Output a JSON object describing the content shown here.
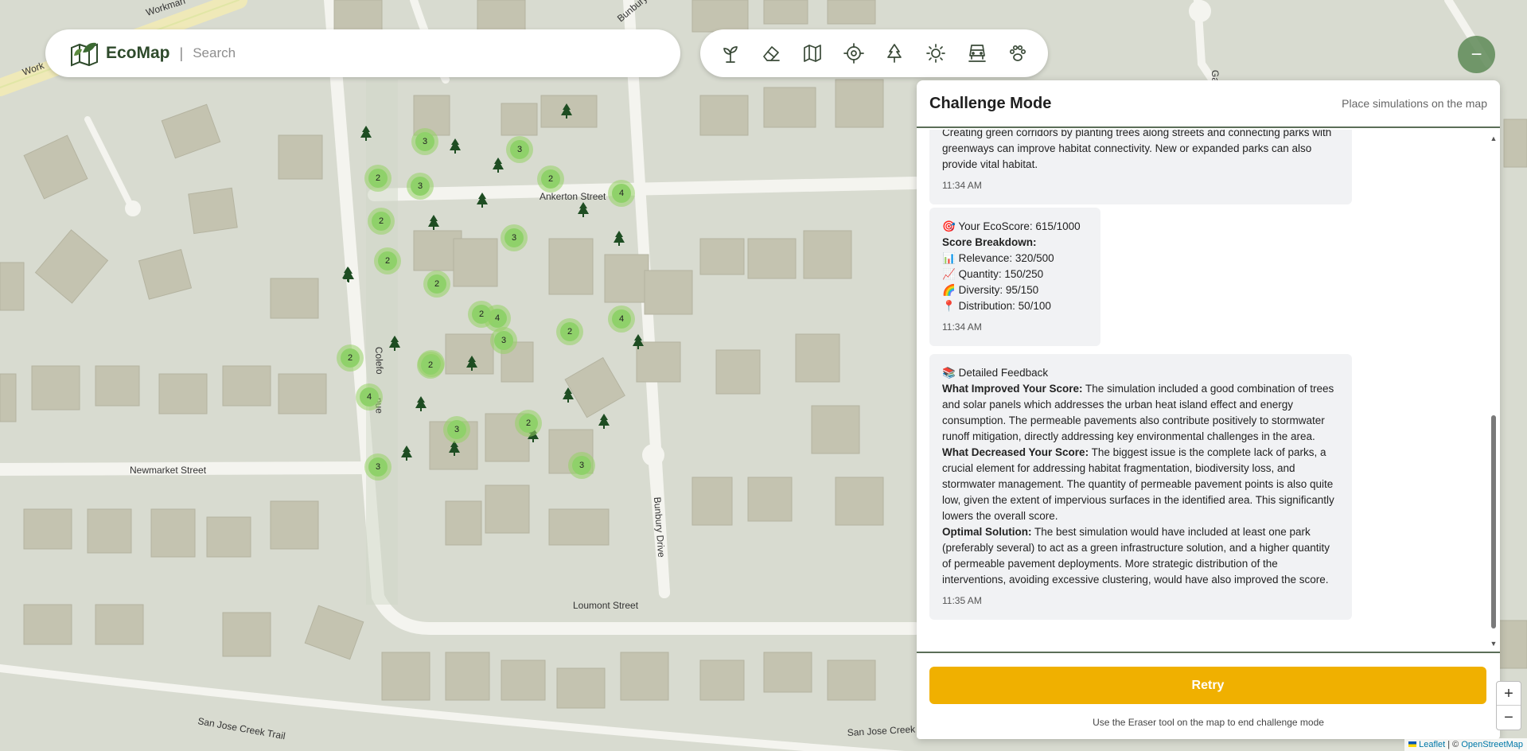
{
  "app": {
    "name": "EcoMap"
  },
  "search": {
    "placeholder": "Search"
  },
  "toolbar": {
    "tools": [
      "sapling-icon",
      "eraser-icon",
      "map-icon",
      "target-icon",
      "tree-icon",
      "sun-icon",
      "vehicle-icon",
      "paw-icon"
    ]
  },
  "map": {
    "streets": [
      "Workman",
      "Ankerton Street",
      "Newmarket Street",
      "Colefo",
      "nue",
      "Bunbury Drive",
      "Loumont Street",
      "San Jose Creek Trail",
      "San Jose Creek Trail",
      "Bunbury D",
      "Ga",
      "Work"
    ],
    "cluster_counts": [
      "3",
      "3",
      "3",
      "2",
      "2",
      "4",
      "2",
      "3",
      "2",
      "2",
      "4",
      "2",
      "3",
      "2",
      "4",
      "2",
      "2",
      "2",
      "4",
      "3",
      "2",
      "3",
      "3"
    ],
    "tree_count": 21
  },
  "panel": {
    "title": "Challenge Mode",
    "subtitle": "Place simulations on the map",
    "messages": [
      {
        "text": "Creating green corridors by planting trees along streets and connecting parks with greenways can improve habitat connectivity. New or expanded parks can also provide vital habitat.",
        "time": "11:34 AM"
      },
      {
        "score_line": "Your EcoScore: 615/1000",
        "breakdown_title": "Score Breakdown:",
        "items": [
          "Relevance: 320/500",
          "Quantity: 150/250",
          "Diversity: 95/150",
          "Distribution: 50/100"
        ],
        "time": "11:34 AM"
      },
      {
        "title": "Detailed Feedback",
        "improved_label": "What Improved Your Score:",
        "improved_text": "The simulation included a good combination of trees and solar panels which addresses the urban heat island effect and energy consumption. The permeable pavements also contribute positively to stormwater runoff mitigation, directly addressing key environmental challenges in the area.",
        "decreased_label": "What Decreased Your Score:",
        "decreased_text": "The biggest issue is the complete lack of parks, a crucial element for addressing habitat fragmentation, biodiversity loss, and stormwater management. The quantity of permeable pavement points is also quite low, given the extent of impervious surfaces in the identified area. This significantly lowers the overall score.",
        "optimal_label": "Optimal Solution:",
        "optimal_text": "The best simulation would have included at least one park (preferably several) to act as a green infrastructure solution, and a higher quantity of permeable pavement deployments. More strategic distribution of the interventions, avoiding excessive clustering, would have also improved the score.",
        "time": "11:35 AM"
      }
    ],
    "retry_label": "Retry",
    "footer_note": "Use the Eraser tool on the map to end challenge mode"
  },
  "zoom": {
    "in": "+",
    "out": "−"
  },
  "attribution": {
    "leaflet": "Leaflet",
    "sep": " | © ",
    "osm": "OpenStreetMap"
  },
  "colors": {
    "accent": "#f0b000",
    "brand": "#2e4a2b",
    "cluster": "#8fd16a"
  }
}
